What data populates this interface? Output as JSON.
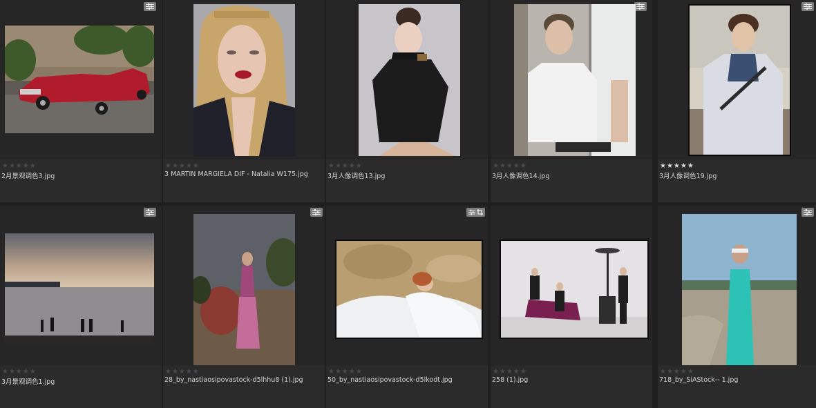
{
  "items": [
    {
      "filename": "2月景观调色3.jpg",
      "rating": 0,
      "badges": [
        "sliders-icon"
      ]
    },
    {
      "filename": "3 MARTIN MARGIELA DIF - Natalia W175.jpg",
      "rating": 0,
      "badges": []
    },
    {
      "filename": "3月人像调色13.jpg",
      "rating": 0,
      "badges": []
    },
    {
      "filename": "3月人像调色14.jpg",
      "rating": 0,
      "badges": [
        "sliders-icon"
      ]
    },
    {
      "filename": "3月人像调色19.jpg",
      "rating": 5,
      "badges": [
        "sliders-icon"
      ]
    },
    {
      "filename": "3月景观调色1.jpg",
      "rating": 0,
      "badges": [
        "sliders-icon"
      ]
    },
    {
      "filename": "28_by_nastiaosipovastock-d5lhhu8 (1).jpg",
      "rating": 0,
      "badges": [
        "sliders-icon"
      ]
    },
    {
      "filename": "50_by_nastiaosipovastock-d5lkodt.jpg",
      "rating": 0,
      "badges": [
        "sliders-icon",
        "crop-icon"
      ]
    },
    {
      "filename": "258 (1).jpg",
      "rating": 0,
      "badges": []
    },
    {
      "filename": "718_by_SiAStock-- 1.jpg",
      "rating": 0,
      "badges": [
        "sliders-icon"
      ]
    }
  ],
  "colors": {
    "background": "#1f1f1f",
    "cell": "#2b2b2b",
    "star_on": "#d8d8d8",
    "star_off": "#4a4a4a"
  }
}
